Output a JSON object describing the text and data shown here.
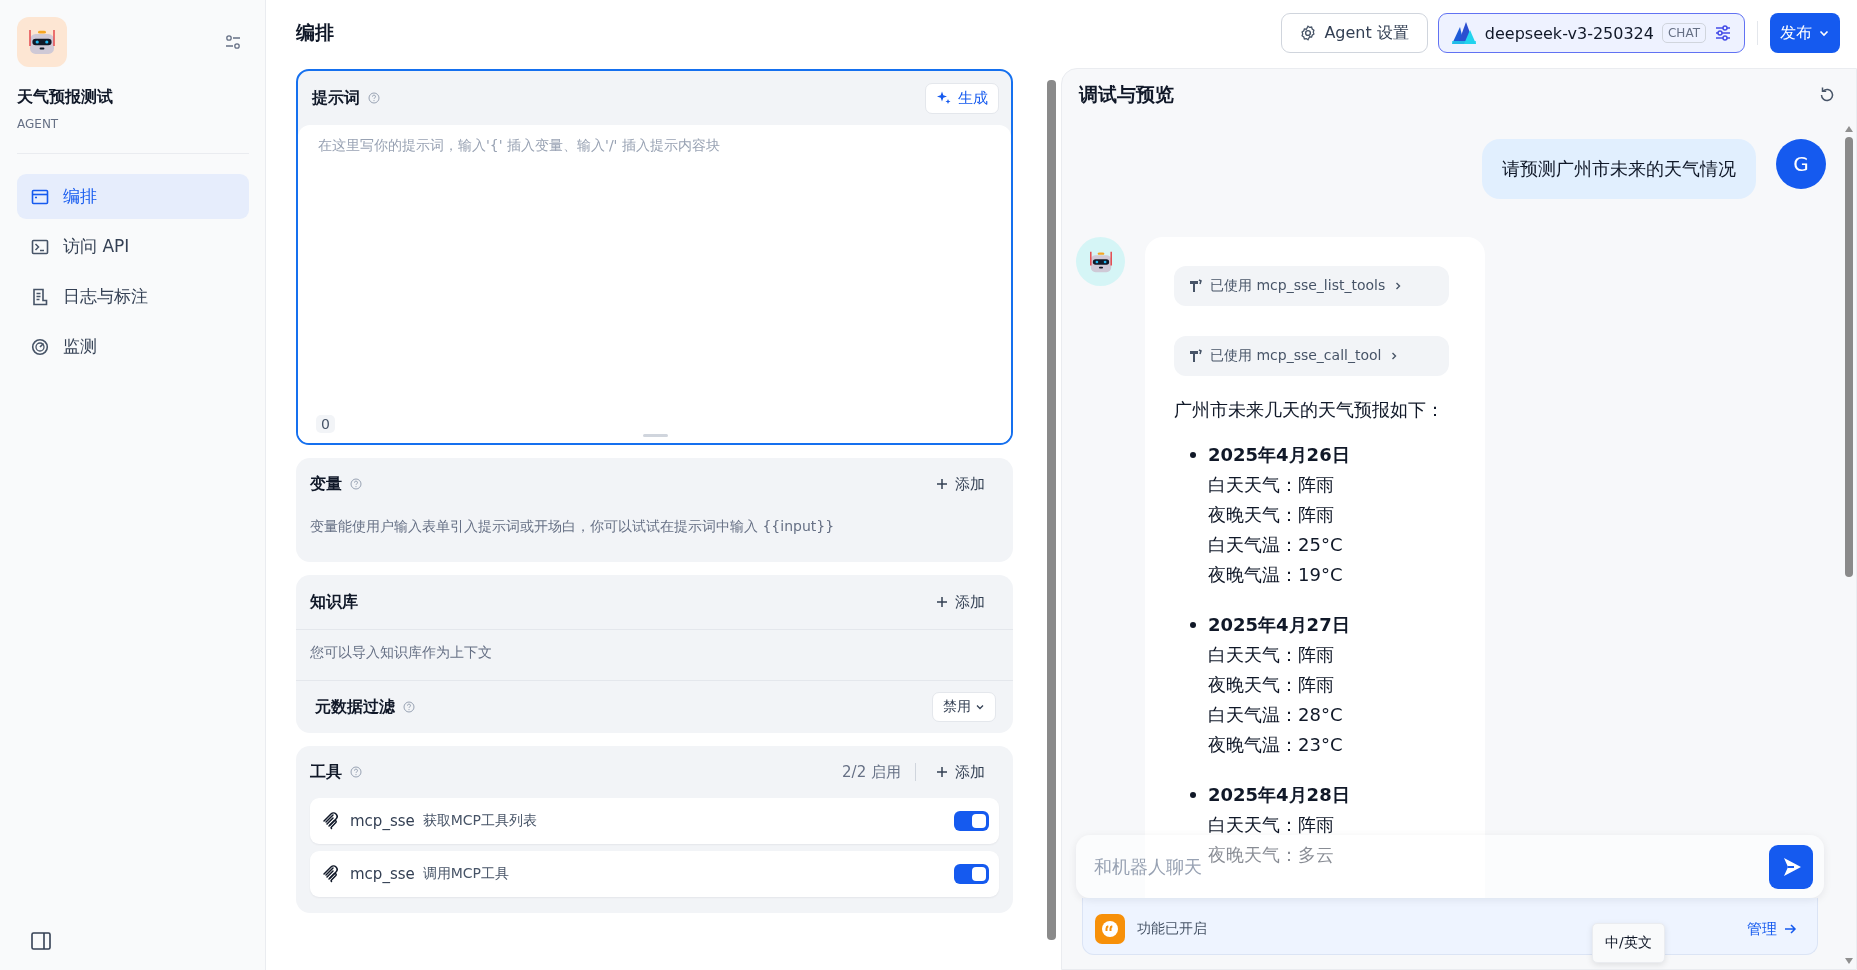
{
  "app": {
    "name": "天气预报测试",
    "type": "AGENT"
  },
  "nav": [
    {
      "label": "编排",
      "kind": "layout",
      "selected": true
    },
    {
      "label": "访问 API",
      "kind": "terminal",
      "selected": false
    },
    {
      "label": "日志与标注",
      "kind": "log",
      "selected": false
    },
    {
      "label": "监测",
      "kind": "monitor",
      "selected": false
    }
  ],
  "header": {
    "title": "编排",
    "agent_settings": "Agent 设置",
    "model": {
      "name": "deepseek-v3-250324",
      "badge": "CHAT"
    },
    "publish": "发布"
  },
  "prompt": {
    "title": "提示词",
    "generate": "生成",
    "placeholder": "在这里写你的提示词，输入'{' 插入变量、输入'/' 插入提示内容块",
    "count": "0"
  },
  "variables": {
    "title": "变量",
    "add": "添加",
    "hint": "变量能使用户输入表单引入提示词或开场白，你可以试试在提示词中输入 {{input}}"
  },
  "knowledge": {
    "title": "知识库",
    "add": "添加",
    "hint": "您可以导入知识库作为上下文",
    "filter": {
      "label": "元数据过滤",
      "value": "禁用"
    }
  },
  "tools": {
    "title": "工具",
    "status": "2/2 启用",
    "add": "添加",
    "items": [
      {
        "provider": "mcp_sse",
        "name": "获取MCP工具列表",
        "on": true
      },
      {
        "provider": "mcp_sse",
        "name": "调用MCP工具",
        "on": true
      }
    ]
  },
  "preview": {
    "title": "调试与预览",
    "messages": [
      {
        "kind": "user",
        "text": "请预测广州市未来的天气情况",
        "avatar": "G"
      },
      {
        "kind": "bot",
        "tool_calls": [
          {
            "label": "已使用 mcp_sse_list_tools"
          },
          {
            "label": "已使用 mcp_sse_call_tool"
          }
        ],
        "intro": "广州市未来几天的天气预报如下：",
        "days": [
          {
            "date": "2025年4月26日",
            "lines": [
              "白天天气：阵雨",
              "夜晚天气：阵雨",
              "白天气温：25°C",
              "夜晚气温：19°C"
            ]
          },
          {
            "date": "2025年4月27日",
            "lines": [
              "白天天气：阵雨",
              "夜晚天气：阵雨",
              "白天气温：28°C",
              "夜晚气温：23°C"
            ]
          },
          {
            "date": "2025年4月28日",
            "lines": [
              "白天天气：阵雨",
              "夜晚天气：多云"
            ]
          }
        ]
      }
    ],
    "input": {
      "placeholder": "和机器人聊天"
    },
    "features": {
      "label": "功能已开启",
      "manage": "管理"
    },
    "tooltip": "中/英文"
  }
}
